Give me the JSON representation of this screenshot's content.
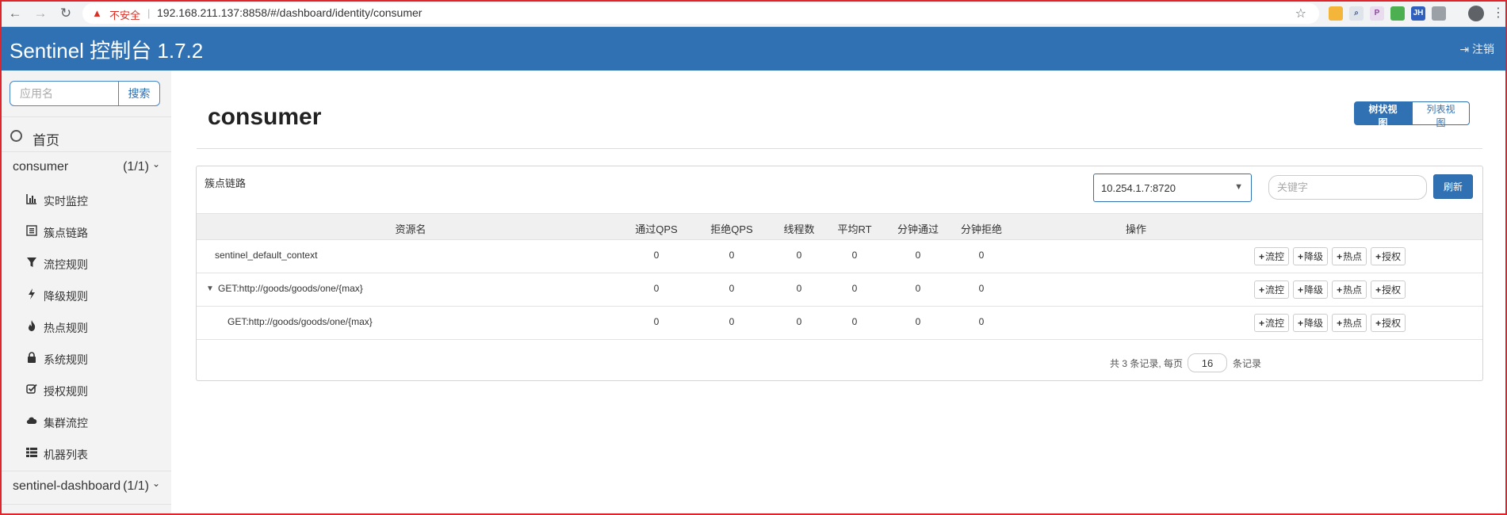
{
  "browser": {
    "insecure_label": "不安全",
    "separator": "|",
    "url": "192.168.211.137:8858/#/dashboard/identity/consumer"
  },
  "header": {
    "brand": "Sentinel 控制台 1.7.2",
    "logout": "注销"
  },
  "sidebar": {
    "search_placeholder": "应用名",
    "search_button": "搜索",
    "home": "首页",
    "apps": [
      {
        "name": "consumer",
        "count": "(1/1)"
      },
      {
        "name": "sentinel-dashboard",
        "count": "(1/1)"
      }
    ],
    "menu": [
      {
        "label": "实时监控",
        "icon": "bar-chart-icon"
      },
      {
        "label": "簇点链路",
        "icon": "list-icon"
      },
      {
        "label": "流控规则",
        "icon": "filter-icon"
      },
      {
        "label": "降级规则",
        "icon": "flash-icon"
      },
      {
        "label": "热点规则",
        "icon": "fire-icon"
      },
      {
        "label": "系统规则",
        "icon": "lock-icon"
      },
      {
        "label": "授权规则",
        "icon": "check-square-icon"
      },
      {
        "label": "集群流控",
        "icon": "cloud-icon"
      },
      {
        "label": "机器列表",
        "icon": "th-list-icon"
      }
    ]
  },
  "main": {
    "title": "consumer",
    "view_tree": "树状视图",
    "view_list": "列表视图",
    "panel_title": "簇点链路",
    "machine": "10.254.1.7:8720",
    "keyword_placeholder": "关键字",
    "refresh": "刷新",
    "columns": [
      "资源名",
      "通过QPS",
      "拒绝QPS",
      "线程数",
      "平均RT",
      "分钟通过",
      "分钟拒绝",
      "操作"
    ],
    "rows": [
      {
        "resource": "sentinel_default_context",
        "pass_qps": "0",
        "block_qps": "0",
        "threads": "0",
        "avg_rt": "0",
        "minute_pass": "0",
        "minute_block": "0"
      },
      {
        "resource": "GET:http://goods/goods/one/{max}",
        "pass_qps": "0",
        "block_qps": "0",
        "threads": "0",
        "avg_rt": "0",
        "minute_pass": "0",
        "minute_block": "0"
      },
      {
        "resource": "GET:http://goods/goods/one/{max}",
        "pass_qps": "0",
        "block_qps": "0",
        "threads": "0",
        "avg_rt": "0",
        "minute_pass": "0",
        "minute_block": "0"
      }
    ],
    "ops": {
      "plus": "+",
      "flow": "流控",
      "degrade": "降级",
      "hot": "热点",
      "auth": "授权"
    },
    "pager": {
      "prefix": "共 3 条记录, 每页",
      "page_size": "16",
      "suffix": "条记录"
    }
  },
  "colors": {
    "header_bg": "#3071b4",
    "sidebar_bg": "#f3f3f3",
    "primary": "#3071b4",
    "warning_red": "#d93025"
  }
}
